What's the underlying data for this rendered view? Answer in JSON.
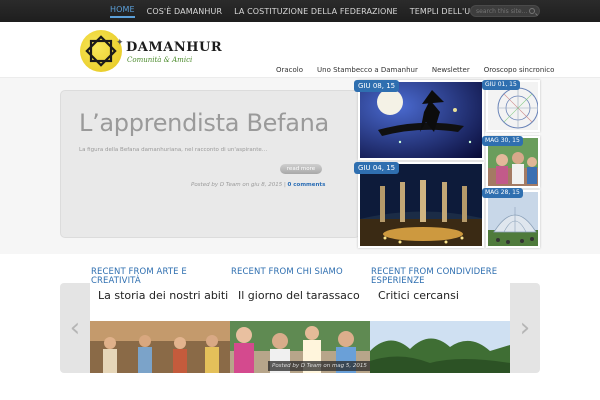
{
  "topbar": {
    "nav": [
      {
        "label": "HOME",
        "active": true
      },
      {
        "label": "COS'È DAMANHUR",
        "active": false
      },
      {
        "label": "LA COSTITUZIONE DELLA FEDERAZIONE",
        "active": false
      },
      {
        "label": "TEMPLI DELL'UMANITÀ",
        "active": false
      }
    ],
    "search_placeholder": "search this site..."
  },
  "brand": {
    "title": "DAMANHUR",
    "subtitle": "Comunità & Amici",
    "logo_icon": "star-logo-icon",
    "accent_yellow": "#f2dc36"
  },
  "mainnav": [
    "Oracolo",
    "Uno Stambecco a Damanhur",
    "Newsletter",
    "Oroscopo sincronico"
  ],
  "feature": {
    "title": "L’apprendista Befana",
    "excerpt": "La figura della Befana damanhuriana, nel racconto di un'aspirante…",
    "read_more": "read more",
    "meta_prefix": "Posted by D Team on giu 8, 2015 |",
    "comments": "0 comments"
  },
  "thumbnails": [
    {
      "date": "GIU 08, 15"
    },
    {
      "date": "GIU 01, 15"
    },
    {
      "date": "MAG 30, 15"
    },
    {
      "date": "GIU 04, 15"
    },
    {
      "date": "MAG 28, 15"
    }
  ],
  "recent": [
    {
      "heading": "RECENT FROM ARTE E CREATIVITÀ",
      "title": "La storia dei nostri abiti"
    },
    {
      "heading": "RECENT FROM CHI SIAMO",
      "title": "Il giorno del tarassaco",
      "meta": "Posted by D Team on mag 5, 2015"
    },
    {
      "heading": "RECENT FROM CONDIVIDERE ESPERIENZE",
      "title": "Critici cercansi"
    }
  ],
  "colors": {
    "accent_blue": "#2f6fb0",
    "topbar": "#242424"
  }
}
